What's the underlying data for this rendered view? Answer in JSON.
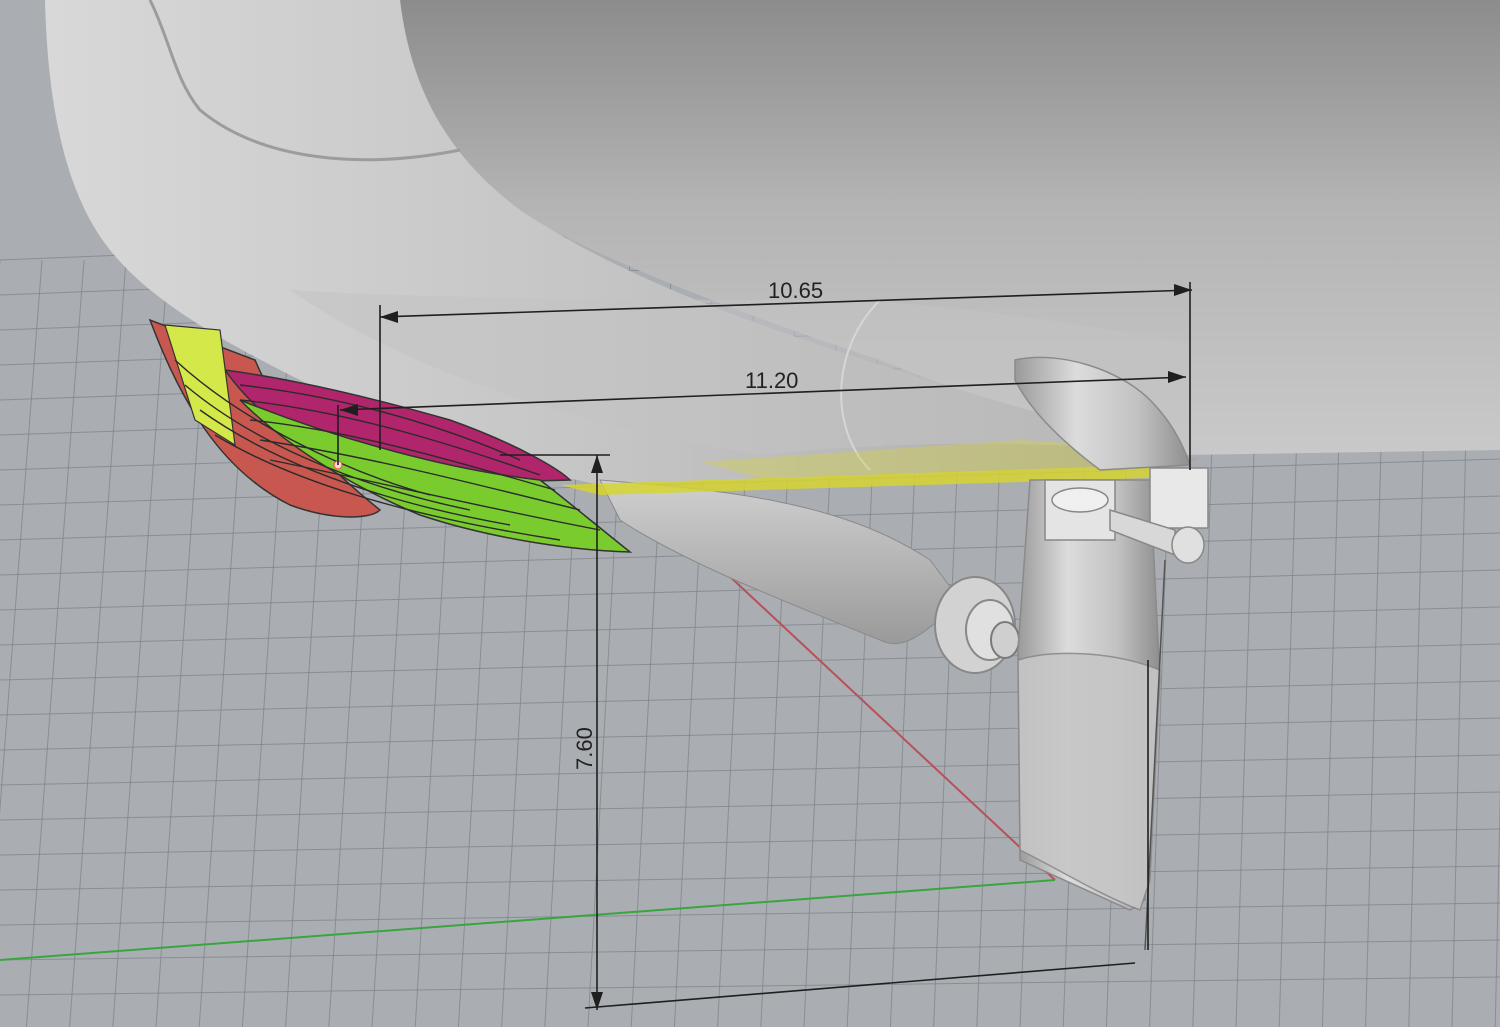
{
  "scene": {
    "background_color": "#aaaeb3",
    "grid_color": "#7b8088",
    "hull_color": "#bdbdbd",
    "x_axis_color": "#b8505a",
    "y_axis_color": "#3aa53e",
    "bulb_section_colors": [
      "#7acc2e",
      "#b0256b",
      "#c8584f",
      "#d4e84a"
    ],
    "waterplane_color": "#d6d430"
  },
  "dimensions": {
    "top_length": "10.65",
    "mid_length": "11.20",
    "height": "7.60"
  }
}
